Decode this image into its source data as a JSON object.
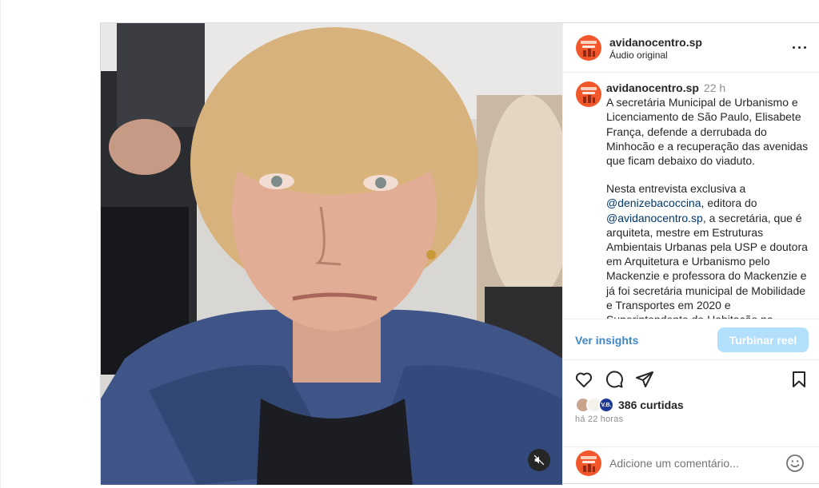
{
  "colors": {
    "brand_orange": "#f2572b",
    "link_blue": "#00376b",
    "insights_blue": "#3f88c5",
    "boost_disabled": "#b2dffc",
    "muted_gray": "#8e8e8e"
  },
  "post": {
    "username": "avidanocentro.sp",
    "audio_label": "Áudio original",
    "more_icon": "more-horizontal-icon",
    "mute_icon": "speaker-muted-icon"
  },
  "caption": {
    "username": "avidanocentro.sp",
    "time": "22 h",
    "paragraph1": "A secretária Municipal de Urbanismo e Licenciamento de São Paulo, Elisabete França, defende a derrubada do Minhocão e a recuperação das avenidas que ficam debaixo do viaduto.",
    "p2_intro": "Nesta entrevista exclusiva a",
    "mention1": "@denizebacoccina",
    "p2_mid": ", editora do",
    "mention2": "@avidanocentro.sp",
    "p2_rest": ", a secretária, que é arquiteta, mestre em Estruturas Ambientais Urbanas pela USP e doutora em Arquitetura e Urbanismo pelo Mackenzie e professora do Mackenzie e já foi secretária municipal de Mobilidade e Transportes em 2020 e Superintendente de Habitação na"
  },
  "insights": {
    "link_label": "Ver insights",
    "boost_label": "Turbinar reel"
  },
  "actions": {
    "like_icon": "heart-icon",
    "comment_icon": "comment-icon",
    "share_icon": "send-icon",
    "save_icon": "bookmark-icon"
  },
  "likes": {
    "badge_text": "V.B.",
    "text": "386 curtidas"
  },
  "timestamp": "há 22 horas",
  "comment": {
    "placeholder": "Adicione um comentário...",
    "emoji_icon": "emoji-icon"
  }
}
